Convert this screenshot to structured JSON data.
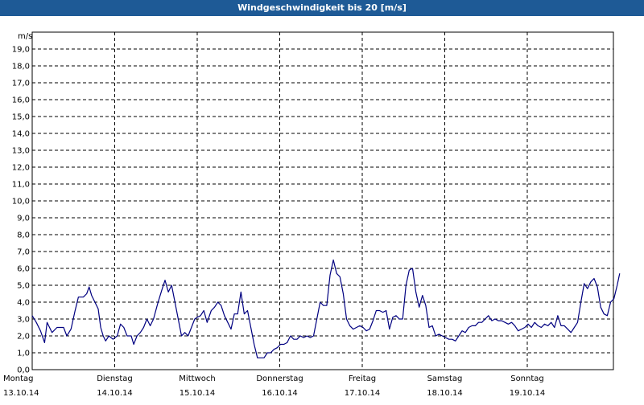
{
  "window": {
    "title": "Windgeschwindigkeit bis 20 [m/s]"
  },
  "chart_data": {
    "type": "line",
    "title": "Windgeschwindigkeit bis 20 [m/s]",
    "ylabel": "m/s",
    "ylim": [
      0,
      20
    ],
    "grid": true,
    "y_ticks": [
      "0,0",
      "1,0",
      "2,0",
      "3,0",
      "4,0",
      "5,0",
      "6,0",
      "7,0",
      "8,0",
      "9,0",
      "10,0",
      "11,0",
      "12,0",
      "13,0",
      "14,0",
      "15,0",
      "16,0",
      "17,0",
      "18,0",
      "19,0"
    ],
    "x_ticks": [
      {
        "day": "Montag",
        "date": "13.10.14"
      },
      {
        "day": "Dienstag",
        "date": "14.10.14"
      },
      {
        "day": "Mittwoch",
        "date": "15.10.14"
      },
      {
        "day": "Donnerstag",
        "date": "16.10.14"
      },
      {
        "day": "Freitag",
        "date": "17.10.14"
      },
      {
        "day": "Samstag",
        "date": "18.10.14"
      },
      {
        "day": "Sonntag",
        "date": "19.10.14"
      }
    ],
    "series": [
      {
        "color": "#000080",
        "x_unit": "days since 13.10.14 00:00",
        "points": [
          [
            0.0,
            3.2
          ],
          [
            0.05,
            2.8
          ],
          [
            0.1,
            2.3
          ],
          [
            0.15,
            1.6
          ],
          [
            0.18,
            2.8
          ],
          [
            0.24,
            2.2
          ],
          [
            0.3,
            2.5
          ],
          [
            0.38,
            2.5
          ],
          [
            0.42,
            2.0
          ],
          [
            0.47,
            2.4
          ],
          [
            0.52,
            3.5
          ],
          [
            0.56,
            4.3
          ],
          [
            0.62,
            4.3
          ],
          [
            0.66,
            4.5
          ],
          [
            0.69,
            4.9
          ],
          [
            0.72,
            4.4
          ],
          [
            0.76,
            4.0
          ],
          [
            0.8,
            3.6
          ],
          [
            0.83,
            2.5
          ],
          [
            0.86,
            2.0
          ],
          [
            0.89,
            1.7
          ],
          [
            0.93,
            2.0
          ],
          [
            0.98,
            1.8
          ],
          [
            1.03,
            2.0
          ],
          [
            1.07,
            2.7
          ],
          [
            1.11,
            2.5
          ],
          [
            1.15,
            2.0
          ],
          [
            1.2,
            2.0
          ],
          [
            1.23,
            1.5
          ],
          [
            1.27,
            2.0
          ],
          [
            1.31,
            2.2
          ],
          [
            1.35,
            2.5
          ],
          [
            1.39,
            3.0
          ],
          [
            1.43,
            2.6
          ],
          [
            1.47,
            3.0
          ],
          [
            1.52,
            3.9
          ],
          [
            1.57,
            4.7
          ],
          [
            1.61,
            5.3
          ],
          [
            1.65,
            4.6
          ],
          [
            1.69,
            5.0
          ],
          [
            1.73,
            4.0
          ],
          [
            1.77,
            3.0
          ],
          [
            1.81,
            2.0
          ],
          [
            1.85,
            2.2
          ],
          [
            1.89,
            2.0
          ],
          [
            1.93,
            2.5
          ],
          [
            1.97,
            3.0
          ],
          [
            2.0,
            3.1
          ],
          [
            2.04,
            3.2
          ],
          [
            2.08,
            3.5
          ],
          [
            2.12,
            2.8
          ],
          [
            2.17,
            3.5
          ],
          [
            2.21,
            3.7
          ],
          [
            2.25,
            4.0
          ],
          [
            2.29,
            3.8
          ],
          [
            2.33,
            3.2
          ],
          [
            2.37,
            2.8
          ],
          [
            2.41,
            2.4
          ],
          [
            2.45,
            3.3
          ],
          [
            2.49,
            3.3
          ],
          [
            2.53,
            4.6
          ],
          [
            2.57,
            3.3
          ],
          [
            2.61,
            3.5
          ],
          [
            2.65,
            2.5
          ],
          [
            2.69,
            1.5
          ],
          [
            2.73,
            0.7
          ],
          [
            2.77,
            0.7
          ],
          [
            2.81,
            0.7
          ],
          [
            2.85,
            1.0
          ],
          [
            2.89,
            1.0
          ],
          [
            2.93,
            1.2
          ],
          [
            2.97,
            1.3
          ],
          [
            3.01,
            1.5
          ],
          [
            3.05,
            1.5
          ],
          [
            3.09,
            1.6
          ],
          [
            3.13,
            2.0
          ],
          [
            3.17,
            1.8
          ],
          [
            3.21,
            1.8
          ],
          [
            3.25,
            2.0
          ],
          [
            3.29,
            1.9
          ],
          [
            3.33,
            2.0
          ],
          [
            3.37,
            1.9
          ],
          [
            3.41,
            2.0
          ],
          [
            3.45,
            3.0
          ],
          [
            3.49,
            4.0
          ],
          [
            3.53,
            3.8
          ],
          [
            3.57,
            3.8
          ],
          [
            3.61,
            5.6
          ],
          [
            3.65,
            6.5
          ],
          [
            3.69,
            5.7
          ],
          [
            3.73,
            5.5
          ],
          [
            3.77,
            4.5
          ],
          [
            3.81,
            3.0
          ],
          [
            3.85,
            2.6
          ],
          [
            3.89,
            2.4
          ],
          [
            3.93,
            2.5
          ],
          [
            3.97,
            2.6
          ],
          [
            4.01,
            2.5
          ],
          [
            4.05,
            2.3
          ],
          [
            4.09,
            2.4
          ],
          [
            4.13,
            2.9
          ],
          [
            4.17,
            3.5
          ],
          [
            4.21,
            3.5
          ],
          [
            4.25,
            3.4
          ],
          [
            4.29,
            3.5
          ],
          [
            4.33,
            2.4
          ],
          [
            4.37,
            3.1
          ],
          [
            4.41,
            3.2
          ],
          [
            4.45,
            3.0
          ],
          [
            4.49,
            3.0
          ],
          [
            4.53,
            5.0
          ],
          [
            4.57,
            5.9
          ],
          [
            4.61,
            6.0
          ],
          [
            4.65,
            4.6
          ],
          [
            4.69,
            3.7
          ],
          [
            4.73,
            4.4
          ],
          [
            4.77,
            3.8
          ],
          [
            4.81,
            2.5
          ],
          [
            4.85,
            2.6
          ],
          [
            4.89,
            2.0
          ],
          [
            4.93,
            2.1
          ],
          [
            4.97,
            2.0
          ],
          [
            5.01,
            1.9
          ],
          [
            5.05,
            1.8
          ],
          [
            5.09,
            1.8
          ],
          [
            5.13,
            1.7
          ],
          [
            5.17,
            2.0
          ],
          [
            5.21,
            2.3
          ],
          [
            5.25,
            2.2
          ],
          [
            5.29,
            2.5
          ],
          [
            5.33,
            2.6
          ],
          [
            5.37,
            2.6
          ],
          [
            5.41,
            2.8
          ],
          [
            5.45,
            2.8
          ],
          [
            5.49,
            3.0
          ],
          [
            5.53,
            3.2
          ],
          [
            5.57,
            2.9
          ],
          [
            5.61,
            3.0
          ],
          [
            5.65,
            2.9
          ],
          [
            5.69,
            2.9
          ],
          [
            5.73,
            2.8
          ],
          [
            5.77,
            2.7
          ],
          [
            5.81,
            2.8
          ],
          [
            5.85,
            2.6
          ],
          [
            5.89,
            2.3
          ],
          [
            5.93,
            2.4
          ],
          [
            5.97,
            2.5
          ],
          [
            6.01,
            2.7
          ],
          [
            6.05,
            2.5
          ],
          [
            6.09,
            2.8
          ],
          [
            6.13,
            2.6
          ],
          [
            6.17,
            2.5
          ],
          [
            6.21,
            2.7
          ],
          [
            6.25,
            2.6
          ],
          [
            6.29,
            2.8
          ],
          [
            6.33,
            2.5
          ],
          [
            6.37,
            3.2
          ],
          [
            6.41,
            2.6
          ],
          [
            6.45,
            2.6
          ],
          [
            6.49,
            2.4
          ],
          [
            6.53,
            2.2
          ],
          [
            6.57,
            2.5
          ],
          [
            6.61,
            2.8
          ],
          [
            6.65,
            4.0
          ],
          [
            6.69,
            5.1
          ],
          [
            6.73,
            4.8
          ],
          [
            6.77,
            5.2
          ],
          [
            6.81,
            5.4
          ],
          [
            6.85,
            4.9
          ],
          [
            6.89,
            3.7
          ],
          [
            6.93,
            3.3
          ],
          [
            6.97,
            3.2
          ],
          [
            7.01,
            4.0
          ],
          [
            7.05,
            4.2
          ],
          [
            7.09,
            5.0
          ],
          [
            7.12,
            5.7
          ]
        ]
      }
    ]
  }
}
